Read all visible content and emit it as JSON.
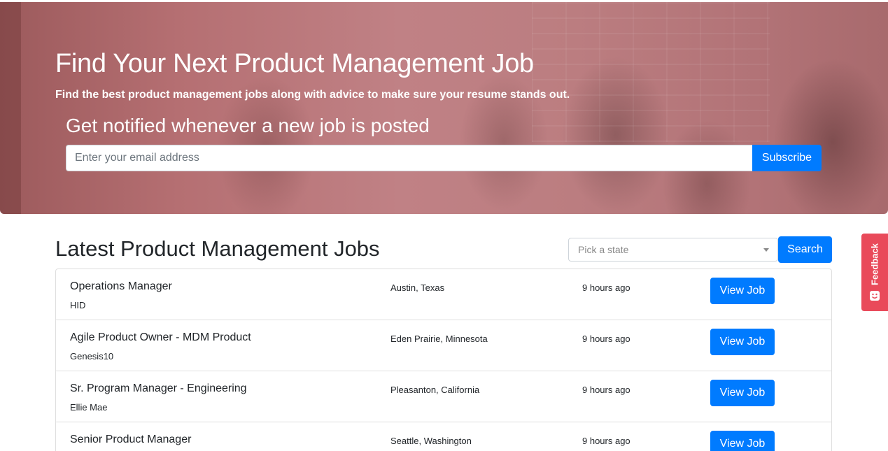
{
  "hero": {
    "title": "Find Your Next Product Management Job",
    "subtitle": "Find the best product management jobs along with advice to make sure your resume stands out.",
    "notify_heading": "Get notified whenever a new job is posted",
    "email_placeholder": "Enter your email address",
    "subscribe_label": "Subscribe",
    "tint_color": "#c08185"
  },
  "jobs_section": {
    "title": "Latest Product Management Jobs",
    "state_placeholder": "Pick a state",
    "search_label": "Search",
    "view_label": "View Job",
    "jobs": [
      {
        "title": "Operations Manager",
        "company": "HID",
        "location": "Austin, Texas",
        "posted": "9 hours ago"
      },
      {
        "title": "Agile Product Owner - MDM Product",
        "company": "Genesis10",
        "location": "Eden Prairie, Minnesota",
        "posted": "9 hours ago"
      },
      {
        "title": "Sr. Program Manager - Engineering",
        "company": "Ellie Mae",
        "location": "Pleasanton, California",
        "posted": "9 hours ago"
      },
      {
        "title": "Senior Product Manager",
        "company": "",
        "location": "Seattle, Washington",
        "posted": "9 hours ago"
      }
    ]
  },
  "feedback": {
    "label": "Feedback",
    "icon": "smile-icon",
    "color": "#e94a5a"
  },
  "theme": {
    "accent": "#007bff"
  }
}
